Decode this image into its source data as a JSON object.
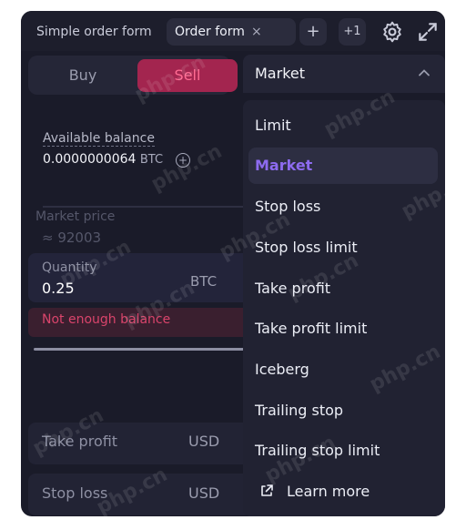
{
  "tabs": {
    "simple_label": "Simple order form",
    "active_label": "Order form",
    "close_glyph": "×",
    "add_glyph": "+",
    "more_count": "+1"
  },
  "side": {
    "buy": "Buy",
    "sell": "Sell",
    "active": "Sell",
    "sell_color": "#ff6b92"
  },
  "balance": {
    "label": "Available balance",
    "value": "0.0000000064",
    "currency": "BTC"
  },
  "market_price": {
    "label": "Market price",
    "value": "≈  92003"
  },
  "quantity": {
    "label": "Quantity",
    "value": "0.25",
    "currency": "BTC"
  },
  "error": {
    "text": "Not enough balance"
  },
  "take_profit": {
    "label": "Take profit",
    "currency": "USD"
  },
  "stop_loss": {
    "label": "Stop loss",
    "currency": "USD"
  },
  "order_type": {
    "selected": "Market",
    "options": [
      "Limit",
      "Market",
      "Stop loss",
      "Stop loss limit",
      "Take profit",
      "Take profit limit",
      "Iceberg",
      "Trailing stop",
      "Trailing stop limit"
    ],
    "learn_more": "Learn more",
    "accent": "#8d6bf0"
  },
  "watermark": "php.cn"
}
